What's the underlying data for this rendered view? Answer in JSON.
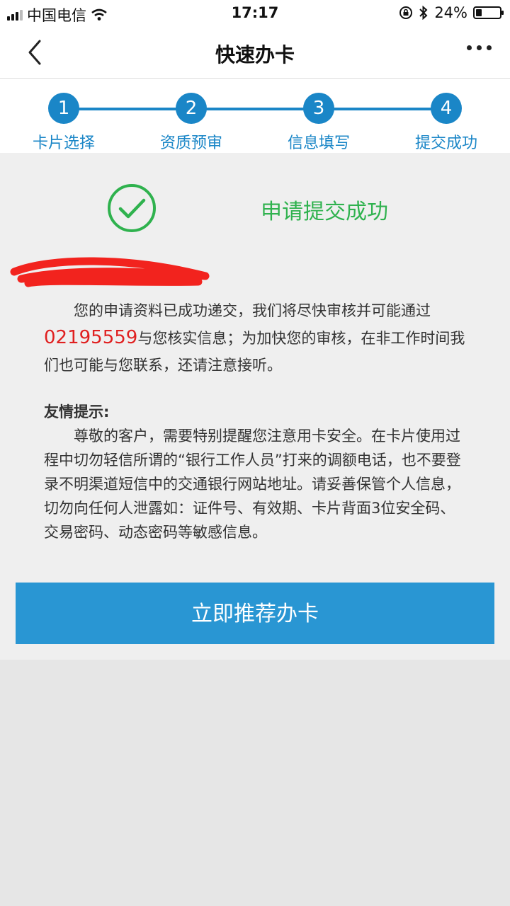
{
  "status_bar": {
    "carrier": "中国电信",
    "time": "17:17",
    "battery": "24%",
    "battery_level": 0.24,
    "icons": [
      "signal-icon",
      "wifi-icon",
      "rotation-lock-icon",
      "bluetooth-icon",
      "battery-icon"
    ]
  },
  "nav": {
    "title": "快速办卡",
    "back_icon": "chevron-left-icon",
    "more_icon": "more-icon"
  },
  "steps": [
    {
      "number": "1",
      "label": "卡片选择"
    },
    {
      "number": "2",
      "label": "资质预审"
    },
    {
      "number": "3",
      "label": "信息填写"
    },
    {
      "number": "4",
      "label": "提交成功"
    }
  ],
  "result": {
    "title": "申请提交成功",
    "icon": "check-circle-icon",
    "message_before": "您的申请资料已成功递交，我们将尽快审核并可能通过",
    "phone": "02195559",
    "message_after": "与您核实信息；为加快您的审核，在非工作时间我们也可能与您联系，还请注意接听。"
  },
  "tips": {
    "title": "友情提示:",
    "body": "尊敬的客户，需要特别提醒您注意用卡安全。在卡片使用过程中切勿轻信所谓的“银行工作人员”打来的调额电话，也不要登录不明渠道短信中的交通银行网站地址。请妥善保管个人信息，切勿向任何人泄露如：证件号、有效期、卡片背面3位安全码、交易密码、动态密码等敏感信息。"
  },
  "cta": {
    "label": "立即推荐办卡"
  },
  "colors": {
    "accent": "#1a86c7",
    "button": "#2996d3",
    "success": "#2fb24e",
    "phone": "#e02020"
  }
}
